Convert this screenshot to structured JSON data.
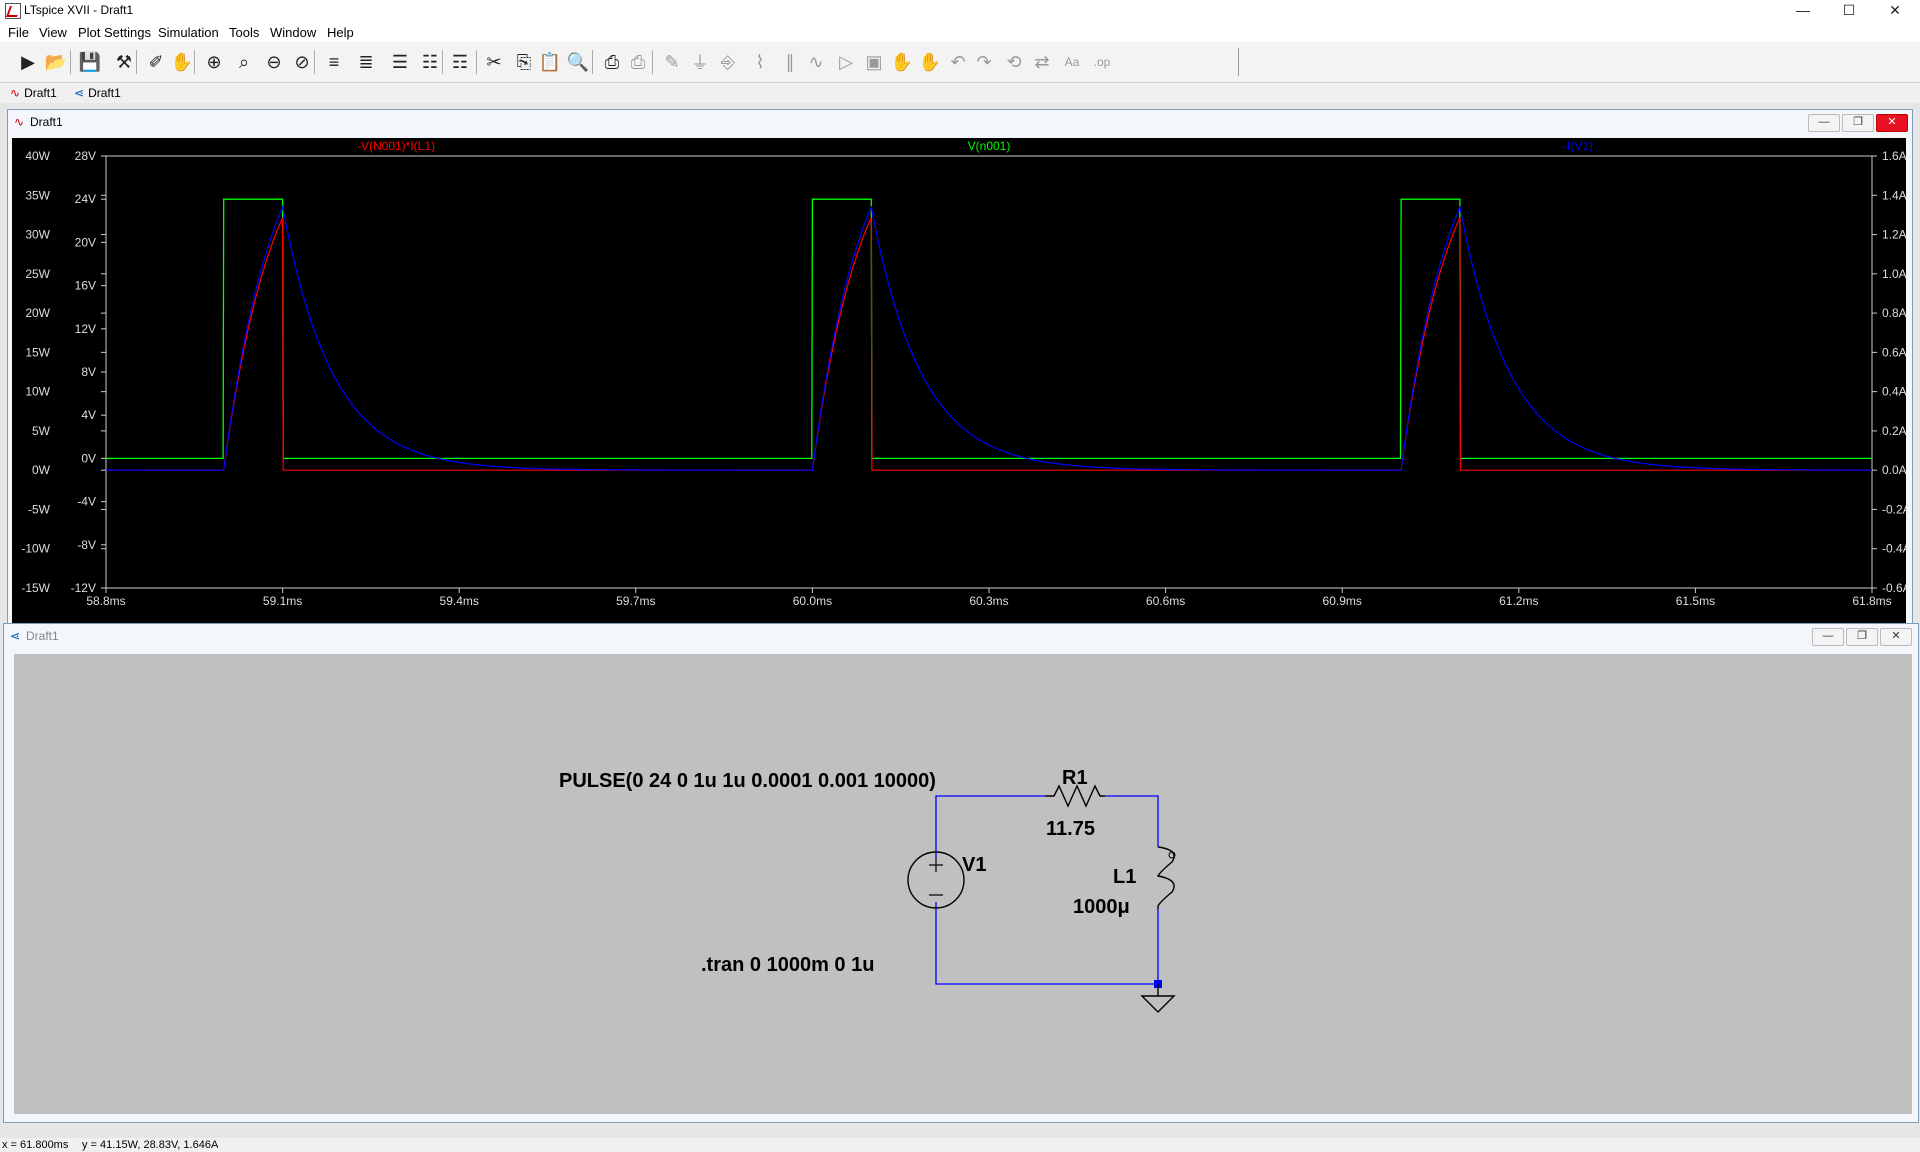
{
  "window": {
    "title": "LTspice XVII - Draft1",
    "buttons": {
      "minimize": "—",
      "maximize": "☐",
      "close": "✕"
    }
  },
  "menu": [
    "File",
    "View",
    "Plot Settings",
    "Simulation",
    "Tools",
    "Window",
    "Help"
  ],
  "toolbar": {
    "icons": [
      "run-icon",
      "open-icon",
      "save-icon",
      "control-panel-icon",
      "halt-icon",
      "pan-icon",
      "zoom-in-icon",
      "zoom-area-icon",
      "zoom-out-icon",
      "zoom-cancel-icon",
      "autorange-icon",
      "manual-limits-icon",
      "tile-horizontal-icon",
      "cascade-icon",
      "tile-vertical-icon",
      "cut-icon",
      "copy-icon",
      "paste-icon",
      "find-icon",
      "print-preview-icon",
      "print-icon",
      "wire-icon",
      "ground-icon",
      "label-icon",
      "resistor-icon",
      "capacitor-icon",
      "inductor-icon",
      "diode-icon",
      "component-icon",
      "move-icon",
      "drag-icon",
      "undo-icon",
      "redo-icon",
      "rotate-icon",
      "mirror-icon",
      "text-icon",
      "spice-directive-icon"
    ]
  },
  "tabs": [
    "Draft1",
    "Draft1"
  ],
  "plot_window": {
    "title": "Draft1",
    "traces": [
      {
        "label": "-V(N001)*I(L1)",
        "color": "#ff0000"
      },
      {
        "label": "V(n001)",
        "color": "#00ff00"
      },
      {
        "label": "-I(V1)",
        "color": "#0000ff"
      }
    ]
  },
  "chart_data": {
    "type": "line",
    "title": "",
    "x_unit": "ms",
    "x_range": [
      58.8,
      61.8
    ],
    "x_ticks": [
      "58.8ms",
      "59.1ms",
      "59.4ms",
      "59.7ms",
      "60.0ms",
      "60.3ms",
      "60.6ms",
      "60.9ms",
      "61.2ms",
      "61.5ms",
      "61.8ms"
    ],
    "y_axis_power": {
      "range": [
        -15,
        40
      ],
      "ticks": [
        "40W",
        "35W",
        "30W",
        "25W",
        "20W",
        "15W",
        "10W",
        "5W",
        "0W",
        "-5W",
        "-10W",
        "-15W"
      ]
    },
    "y_axis_voltage": {
      "range": [
        -12,
        28
      ],
      "ticks": [
        "28V",
        "24V",
        "20V",
        "16V",
        "12V",
        "8V",
        "4V",
        "0V",
        "-4V",
        "-8V",
        "-12V"
      ]
    },
    "y_axis_current": {
      "range": [
        -0.6,
        1.6
      ],
      "ticks": [
        "1.6A",
        "1.4A",
        "1.2A",
        "1.0A",
        "0.8A",
        "0.6A",
        "0.4A",
        "0.2A",
        "0.0A",
        "-0.2A",
        "-0.4A",
        "-0.6A"
      ]
    },
    "pulse": {
      "period_ms": 1.0,
      "width_ms": 0.1,
      "first_rise_ms": 59.0,
      "high_v": 24,
      "low_v": 0
    },
    "peak_current_a": 1.34,
    "tau_ms": 0.0851,
    "series": [
      {
        "name": "-V(N001)*I(L1)",
        "axis": "power",
        "peak": 32.2
      },
      {
        "name": "V(n001)",
        "axis": "voltage",
        "high": 24,
        "low": 0
      },
      {
        "name": "-I(V1)",
        "axis": "current",
        "peak": 1.34
      }
    ]
  },
  "schematic": {
    "title": "Draft1",
    "source_value": "PULSE(0 24 0 1u 1u 0.0001 0.001 10000)",
    "v1_name": "V1",
    "r1_name": "R1",
    "r1_value": "11.75",
    "l1_name": "L1",
    "l1_value": "1000μ",
    "directive": ".tran 0 1000m 0 1u"
  },
  "status": {
    "x_readout": "x = 61.800ms",
    "y_readout": "y = 41.15W, 28.83V, 1.646A"
  }
}
